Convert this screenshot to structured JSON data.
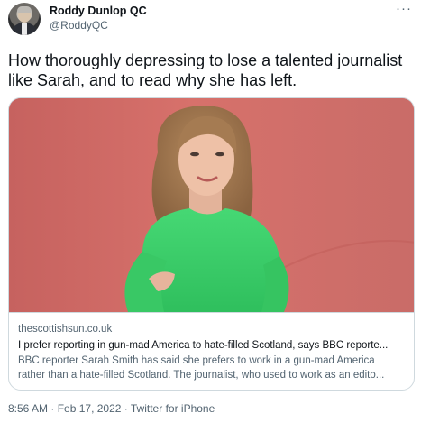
{
  "author": {
    "name": "Roddy Dunlop QC",
    "handle": "@RoddyQC"
  },
  "more_icon": "more-horizontal-icon",
  "tweet": {
    "text": "How thoroughly depressing to lose a talented journalist like Sarah, and to read why she has left."
  },
  "card": {
    "domain": "thescottishsun.co.uk",
    "title": "I prefer reporting in gun-mad America to hate-filled Scotland, says BBC reporte...",
    "description_line1": "BBC reporter Sarah Smith has said she prefers to work in a gun-mad America",
    "description_line2": "rather than a hate-filled Scotland. The journalist, who used to work as an edito..."
  },
  "meta": {
    "time": "8:56 AM",
    "separator": " · ",
    "date": "Feb 17, 2022",
    "source": "Twitter for iPhone"
  },
  "colors": {
    "text": "#0f1419",
    "secondary": "#536471",
    "border": "#cfd9de",
    "photo_background": "#d56d68",
    "sweater": "#3fcf6a"
  }
}
